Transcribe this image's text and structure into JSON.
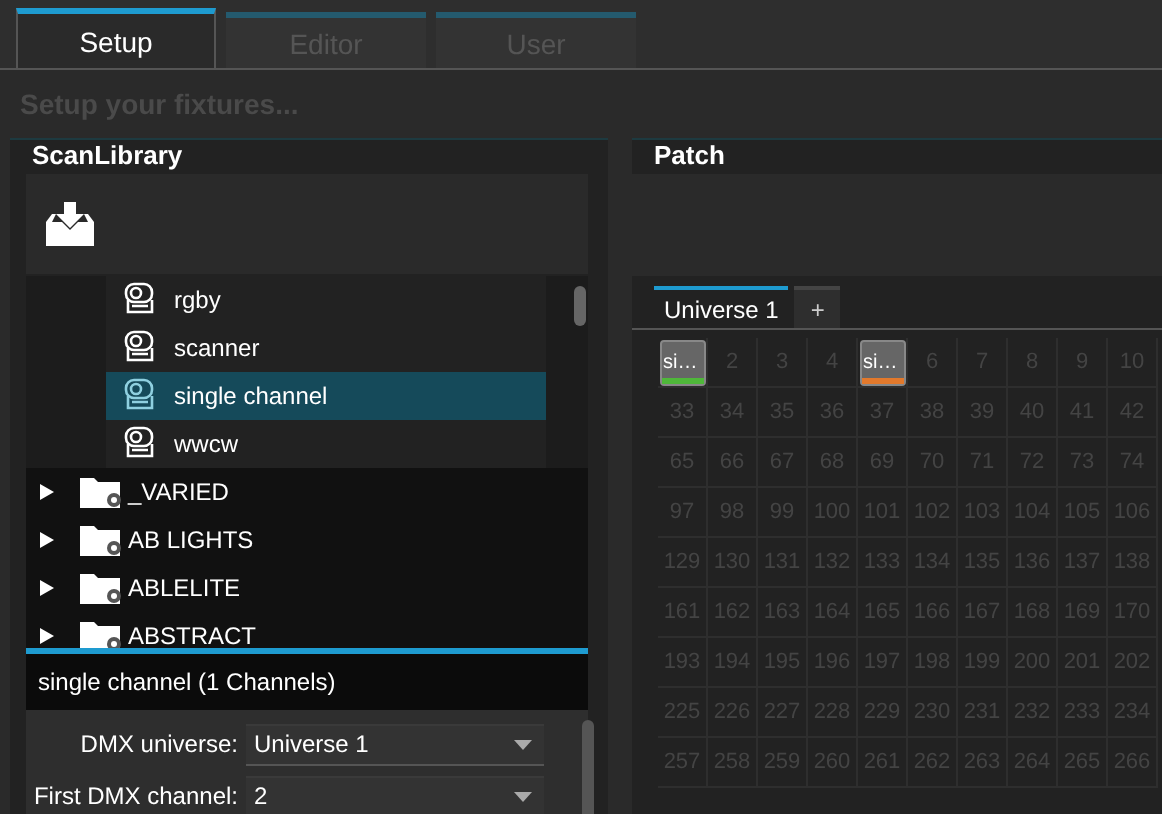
{
  "tabs": [
    {
      "label": "Setup",
      "selected": true
    },
    {
      "label": "Editor",
      "selected": false
    },
    {
      "label": "User",
      "selected": false
    }
  ],
  "heading": "Setup your fixtures...",
  "library": {
    "title": "ScanLibrary",
    "items": [
      {
        "kind": "fixture",
        "label": "rgby",
        "selected": false
      },
      {
        "kind": "fixture",
        "label": "scanner",
        "selected": false
      },
      {
        "kind": "fixture",
        "label": "single channel",
        "selected": true
      },
      {
        "kind": "fixture",
        "label": "wwcw",
        "selected": false
      },
      {
        "kind": "folder",
        "label": "_VARIED",
        "expanded": false
      },
      {
        "kind": "folder",
        "label": "AB LIGHTS",
        "expanded": false
      },
      {
        "kind": "folder",
        "label": "ABLELITE",
        "expanded": false
      },
      {
        "kind": "folder",
        "label": "ABSTRACT",
        "expanded": false
      }
    ],
    "info": "single channel (1 Channels)",
    "fields": [
      {
        "label": "DMX universe:",
        "value": "Universe 1"
      },
      {
        "label": "First DMX channel:",
        "value": "2"
      }
    ]
  },
  "patch": {
    "title": "Patch",
    "tabs": [
      {
        "label": "Universe 1",
        "selected": true
      },
      {
        "label": "+",
        "selected": false
      }
    ],
    "rows": [
      [
        {
          "label": "si…",
          "color": "#4fb83a"
        },
        "2",
        "3",
        "4",
        {
          "label": "si…",
          "color": "#e2792c"
        },
        "6",
        "7",
        "8",
        "9",
        "10"
      ],
      [
        "33",
        "34",
        "35",
        "36",
        "37",
        "38",
        "39",
        "40",
        "41",
        "42"
      ],
      [
        "65",
        "66",
        "67",
        "68",
        "69",
        "70",
        "71",
        "72",
        "73",
        "74"
      ],
      [
        "97",
        "98",
        "99",
        "100",
        "101",
        "102",
        "103",
        "104",
        "105",
        "106"
      ],
      [
        "129",
        "130",
        "131",
        "132",
        "133",
        "134",
        "135",
        "136",
        "137",
        "138"
      ],
      [
        "161",
        "162",
        "163",
        "164",
        "165",
        "166",
        "167",
        "168",
        "169",
        "170"
      ],
      [
        "193",
        "194",
        "195",
        "196",
        "197",
        "198",
        "199",
        "200",
        "201",
        "202"
      ],
      [
        "225",
        "226",
        "227",
        "228",
        "229",
        "230",
        "231",
        "232",
        "233",
        "234"
      ],
      [
        "257",
        "258",
        "259",
        "260",
        "261",
        "262",
        "263",
        "264",
        "265",
        "266"
      ]
    ]
  }
}
